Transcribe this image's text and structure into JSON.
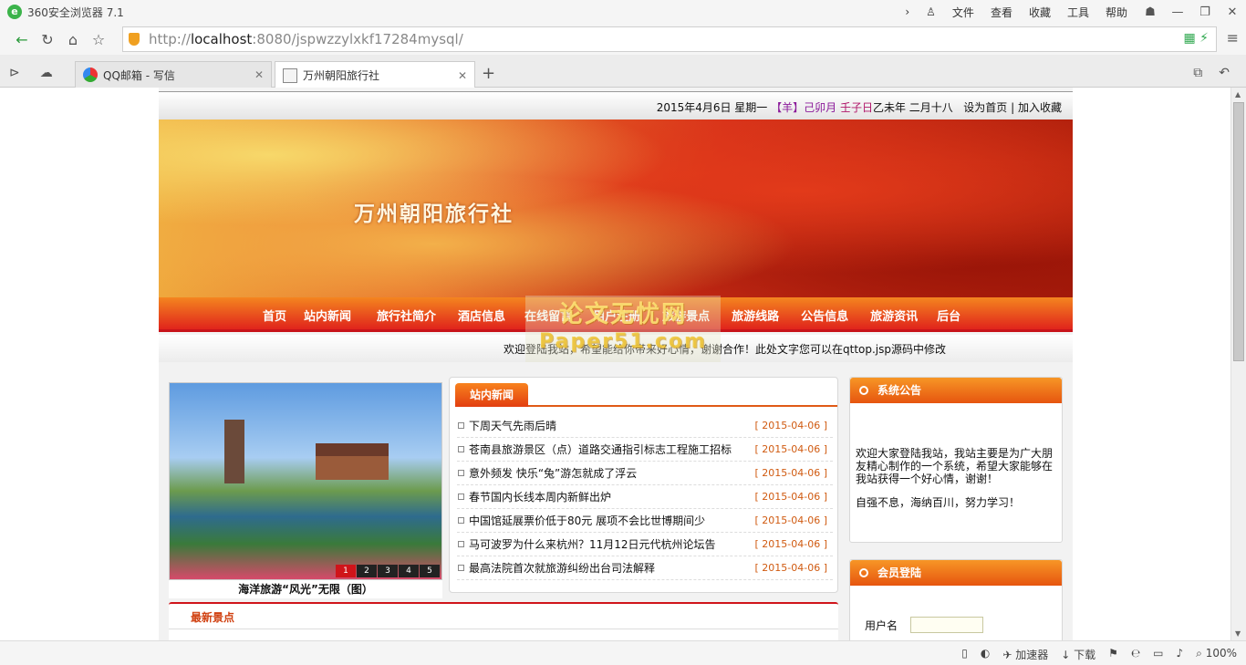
{
  "browser": {
    "app_title": "360安全浏览器 7.1",
    "menus": [
      "文件",
      "查看",
      "收藏",
      "工具",
      "帮助"
    ],
    "url_prefix": "http://",
    "url_host": "localhost",
    "url_rest": ":8080/jspwzzylxkf17284mysql/",
    "tabs": [
      {
        "label": "QQ邮箱 - 写信"
      },
      {
        "label": "万州朝阳旅行社"
      }
    ],
    "status": {
      "accelerator": "加速器",
      "download": "下载",
      "zoom": "100%"
    }
  },
  "site": {
    "date_prefix": "2015年4月6日  星期一  ",
    "date_lunar_a": "【羊】己卯月  ",
    "date_lunar_b": "壬子日",
    "date_lunar_c": "乙未年  二月十八",
    "set_home": "设为首页",
    "separator": "|",
    "add_fav": "加入收藏",
    "title": "万州朝阳旅行社",
    "nav": [
      "首页",
      "站内新闻",
      "旅行社简介",
      "酒店信息",
      "在线留言",
      "用户注册",
      "旅游景点",
      "旅游线路",
      "公告信息",
      "旅游资讯",
      "后台"
    ],
    "welcome": "欢迎登陆我站，希望能给你带来好心情，谢谢合作！此处文字您可以在qttop.jsp源码中修改",
    "watermark_cn": "论文无忧网",
    "watermark_en": "Paper51.com",
    "photo_caption": "海洋旅游“风光”无限（图）",
    "photo_pages": [
      "1",
      "2",
      "3",
      "4",
      "5"
    ],
    "news_title": "站内新闻",
    "news": [
      {
        "title": "下周天气先雨后晴",
        "date": "[ 2015-04-06 ]"
      },
      {
        "title": "苍南县旅游景区（点）道路交通指引标志工程施工招标",
        "date": "[ 2015-04-06 ]"
      },
      {
        "title": "意外频发 快乐“兔”游怎就成了浮云",
        "date": "[ 2015-04-06 ]"
      },
      {
        "title": "春节国内长线本周内新鲜出炉",
        "date": "[ 2015-04-06 ]"
      },
      {
        "title": "中国馆延展票价低于80元 展项不会比世博期间少",
        "date": "[ 2015-04-06 ]"
      },
      {
        "title": "马可波罗为什么来杭州？11月12日元代杭州论坛告",
        "date": "[ 2015-04-06 ]"
      },
      {
        "title": "最高法院首次就旅游纠纷出台司法解释",
        "date": "[ 2015-04-06 ]"
      }
    ],
    "notice_title": "系统公告",
    "notice_p1": "欢迎大家登陆我站，我站主要是为广大朋友精心制作的一个系统，希望大家能够在我站获得一个好心情，谢谢！",
    "notice_p2": "自强不息，海纳百川，努力学习！",
    "login_title": "会员登陆",
    "login_user_label": "用户名",
    "latest_title": "最新景点"
  }
}
